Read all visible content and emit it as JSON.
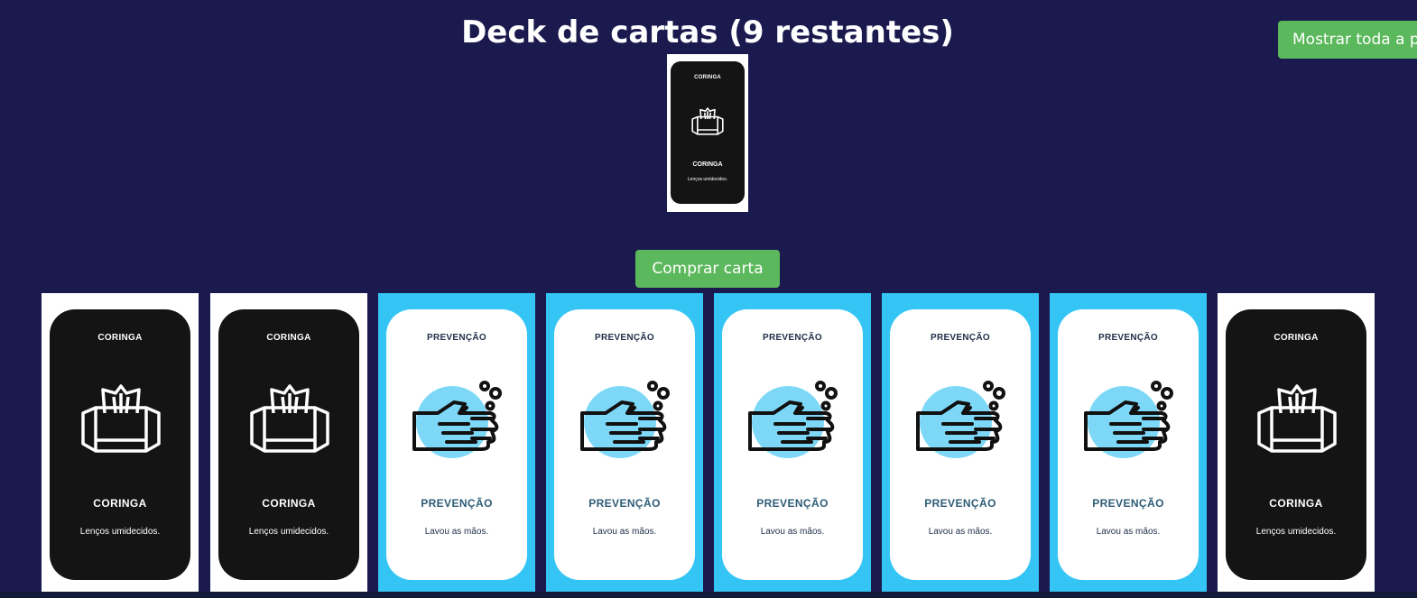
{
  "deck": {
    "title": "Deck de cartas (9 restantes)",
    "top_card": {
      "type": "coringa",
      "header": "CORINGA",
      "title": "CORINGA",
      "description": "Lenços umidecidos.",
      "icon": "wet-wipes-icon"
    }
  },
  "buttons": {
    "show_all": "Mostrar toda a p",
    "buy_card": "Comprar carta"
  },
  "colors": {
    "background": "#1b1a4e",
    "button": "#5cb85c",
    "coringa_card": "#141414",
    "prevencao_card_border": "#35c5f5",
    "prevencao_title": "#2d5c78"
  },
  "hand": [
    {
      "type": "coringa",
      "header": "CORINGA",
      "title": "CORINGA",
      "description": "Lenços umidecidos.",
      "icon": "wet-wipes-icon"
    },
    {
      "type": "coringa",
      "header": "CORINGA",
      "title": "CORINGA",
      "description": "Lenços umidecidos.",
      "icon": "wet-wipes-icon"
    },
    {
      "type": "prevencao",
      "header": "PREVENÇÃO",
      "title": "PREVENÇÃO",
      "description": "Lavou as mãos.",
      "icon": "hand-washing-icon"
    },
    {
      "type": "prevencao",
      "header": "PREVENÇÃO",
      "title": "PREVENÇÃO",
      "description": "Lavou as mãos.",
      "icon": "hand-washing-icon"
    },
    {
      "type": "prevencao",
      "header": "PREVENÇÃO",
      "title": "PREVENÇÃO",
      "description": "Lavou as mãos.",
      "icon": "hand-washing-icon"
    },
    {
      "type": "prevencao",
      "header": "PREVENÇÃO",
      "title": "PREVENÇÃO",
      "description": "Lavou as mãos.",
      "icon": "hand-washing-icon"
    },
    {
      "type": "prevencao",
      "header": "PREVENÇÃO",
      "title": "PREVENÇÃO",
      "description": "Lavou as mãos.",
      "icon": "hand-washing-icon"
    },
    {
      "type": "coringa",
      "header": "CORINGA",
      "title": "CORINGA",
      "description": "Lenços umidecidos.",
      "icon": "wet-wipes-icon"
    }
  ]
}
